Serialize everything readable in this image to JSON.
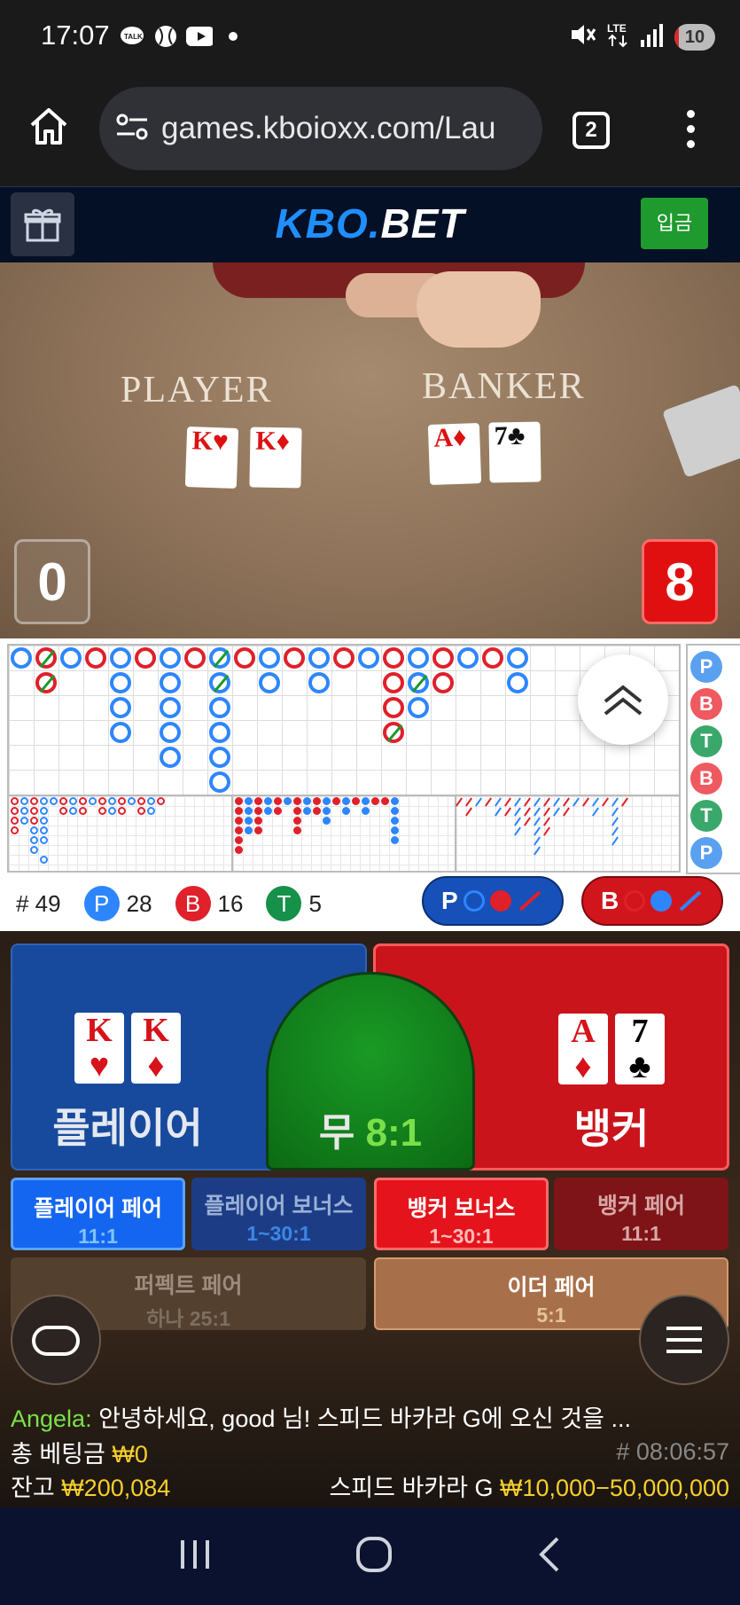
{
  "status_bar": {
    "time": "17:07",
    "battery": "10",
    "battery_level_pct": 10
  },
  "browser": {
    "url": "games.kboioxx.com/Lau",
    "tab_count": "2"
  },
  "site": {
    "logo_part1": "KBO.",
    "logo_part2": "BET",
    "deposit_label": "입금"
  },
  "video": {
    "player_label": "PLAYER",
    "banker_label": "BANKER",
    "player_score": "0",
    "banker_score": "8",
    "player_cards": [
      {
        "rank": "K",
        "suit": "♥"
      },
      {
        "rank": "K",
        "suit": "♦"
      }
    ],
    "banker_cards": [
      {
        "rank": "A",
        "suit": "♦"
      },
      {
        "rank": "7",
        "suit": "♣"
      }
    ]
  },
  "roadmap": {
    "side_predictions": [
      "P",
      "B",
      "T",
      "B",
      "T",
      "P"
    ],
    "stats": {
      "total_label": "# 49",
      "p_letter": "P",
      "p_count": "28",
      "b_letter": "B",
      "b_count": "16",
      "t_letter": "T",
      "t_count": "5"
    },
    "predict_player_label": "P",
    "predict_banker_label": "B"
  },
  "betting": {
    "player_label": "플레이어",
    "banker_label": "뱅커",
    "tie_label": "무",
    "tie_odds": "8:1",
    "player_cards": [
      {
        "rank": "K",
        "suit": "♥"
      },
      {
        "rank": "K",
        "suit": "♦"
      }
    ],
    "banker_cards": [
      {
        "rank": "A",
        "suit": "♦"
      },
      {
        "rank": "7",
        "suit": "♣"
      }
    ],
    "side_bets": {
      "player_pair": {
        "name": "플레이어 페어",
        "odds": "11:1"
      },
      "player_bonus": {
        "name": "플레이어 보너스",
        "odds": "1~30:1"
      },
      "banker_bonus": {
        "name": "뱅커 보너스",
        "odds": "1~30:1"
      },
      "banker_pair": {
        "name": "뱅커 페어",
        "odds": "11:1"
      },
      "perfect_pair": {
        "name": "퍼펙트 페어",
        "odds": "하나 25:1"
      },
      "either_pair": {
        "name": "이더 페어",
        "odds": "5:1"
      }
    }
  },
  "chat": {
    "user": "Angela:",
    "message": "안녕하세요, good 님! 스피드 바카라 G에 오신 것을 ..."
  },
  "footer": {
    "total_bet_label": "총 베팅금",
    "total_bet_value": "₩0",
    "round_id": "# 08:06:57",
    "balance_label": "잔고",
    "balance_value": "₩200,084",
    "table_name": "스피드 바카라 G",
    "limits": "₩10,000−50,000,000"
  },
  "colors": {
    "player_blue": "#174a9c",
    "banker_red": "#c9141b",
    "tie_green": "#1a9a25",
    "gold": "#f6cf2b"
  }
}
